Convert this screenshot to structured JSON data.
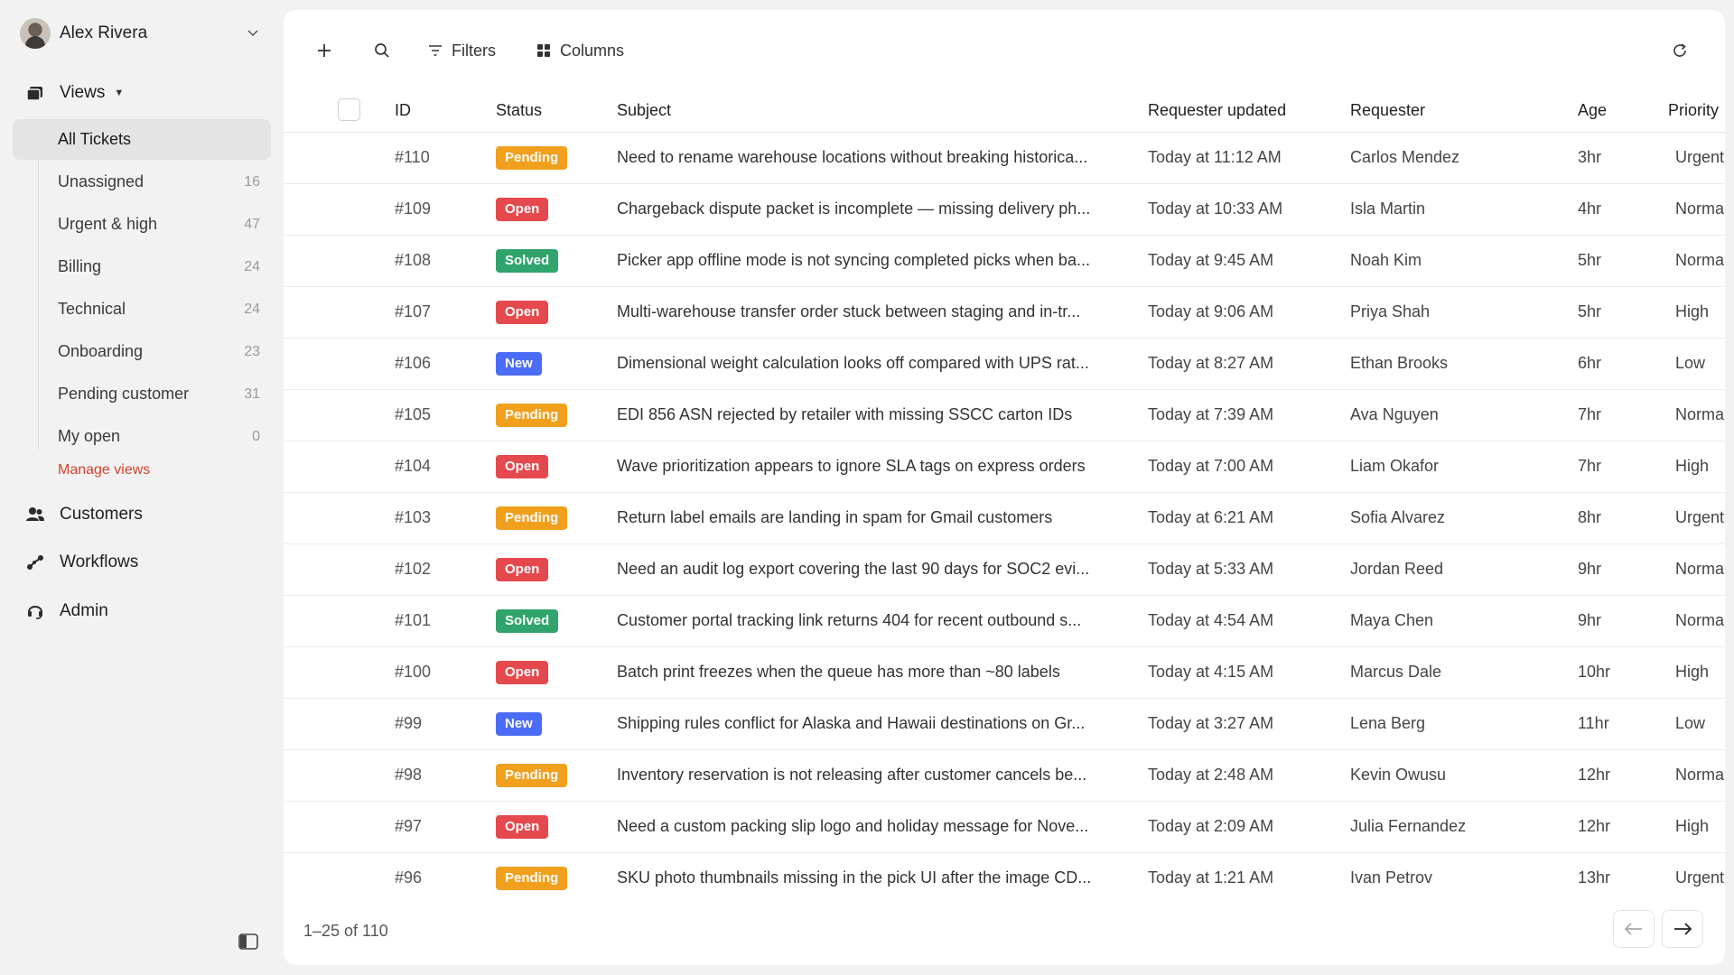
{
  "user": {
    "name": "Alex Rivera"
  },
  "nav": {
    "views_label": "Views",
    "views": [
      {
        "label": "All Tickets",
        "count": "",
        "active": true
      },
      {
        "label": "Unassigned",
        "count": "16"
      },
      {
        "label": "Urgent & high",
        "count": "47"
      },
      {
        "label": "Billing",
        "count": "24"
      },
      {
        "label": "Technical",
        "count": "24"
      },
      {
        "label": "Onboarding",
        "count": "23"
      },
      {
        "label": "Pending customer",
        "count": "31"
      },
      {
        "label": "My open",
        "count": "0"
      }
    ],
    "manage_views": "Manage views",
    "customers": "Customers",
    "workflows": "Workflows",
    "admin": "Admin"
  },
  "toolbar": {
    "filters": "Filters",
    "columns": "Columns"
  },
  "table": {
    "headers": {
      "id": "ID",
      "status": "Status",
      "subject": "Subject",
      "updated": "Requester updated",
      "requester": "Requester",
      "age": "Age",
      "priority": "Priority"
    },
    "rows": [
      {
        "id": "#110",
        "status": "Pending",
        "subject": "Need to rename warehouse locations without breaking historica...",
        "updated": "Today at 11:12 AM",
        "requester": "Carlos Mendez",
        "age": "3hr",
        "priority": "Urgent"
      },
      {
        "id": "#109",
        "status": "Open",
        "subject": "Chargeback dispute packet is incomplete — missing delivery ph...",
        "updated": "Today at 10:33 AM",
        "requester": "Isla Martin",
        "age": "4hr",
        "priority": "Normal"
      },
      {
        "id": "#108",
        "status": "Solved",
        "subject": "Picker app offline mode is not syncing completed picks when ba...",
        "updated": "Today at 9:45 AM",
        "requester": "Noah Kim",
        "age": "5hr",
        "priority": "Normal"
      },
      {
        "id": "#107",
        "status": "Open",
        "subject": "Multi-warehouse transfer order stuck between staging and in-tr...",
        "updated": "Today at 9:06 AM",
        "requester": "Priya Shah",
        "age": "5hr",
        "priority": "High"
      },
      {
        "id": "#106",
        "status": "New",
        "subject": "Dimensional weight calculation looks off compared with UPS rat...",
        "updated": "Today at 8:27 AM",
        "requester": "Ethan Brooks",
        "age": "6hr",
        "priority": "Low"
      },
      {
        "id": "#105",
        "status": "Pending",
        "subject": "EDI 856 ASN rejected by retailer with missing SSCC carton IDs",
        "updated": "Today at 7:39 AM",
        "requester": "Ava Nguyen",
        "age": "7hr",
        "priority": "Normal"
      },
      {
        "id": "#104",
        "status": "Open",
        "subject": "Wave prioritization appears to ignore SLA tags on express orders",
        "updated": "Today at 7:00 AM",
        "requester": "Liam Okafor",
        "age": "7hr",
        "priority": "High"
      },
      {
        "id": "#103",
        "status": "Pending",
        "subject": "Return label emails are landing in spam for Gmail customers",
        "updated": "Today at 6:21 AM",
        "requester": "Sofia Alvarez",
        "age": "8hr",
        "priority": "Urgent"
      },
      {
        "id": "#102",
        "status": "Open",
        "subject": "Need an audit log export covering the last 90 days for SOC2 evi...",
        "updated": "Today at 5:33 AM",
        "requester": "Jordan Reed",
        "age": "9hr",
        "priority": "Normal"
      },
      {
        "id": "#101",
        "status": "Solved",
        "subject": "Customer portal tracking link returns 404 for recent outbound s...",
        "updated": "Today at 4:54 AM",
        "requester": "Maya Chen",
        "age": "9hr",
        "priority": "Normal"
      },
      {
        "id": "#100",
        "status": "Open",
        "subject": "Batch print freezes when the queue has more than ~80 labels",
        "updated": "Today at 4:15 AM",
        "requester": "Marcus Dale",
        "age": "10hr",
        "priority": "High"
      },
      {
        "id": "#99",
        "status": "New",
        "subject": "Shipping rules conflict for Alaska and Hawaii destinations on Gr...",
        "updated": "Today at 3:27 AM",
        "requester": "Lena Berg",
        "age": "11hr",
        "priority": "Low"
      },
      {
        "id": "#98",
        "status": "Pending",
        "subject": "Inventory reservation is not releasing after customer cancels be...",
        "updated": "Today at 2:48 AM",
        "requester": "Kevin Owusu",
        "age": "12hr",
        "priority": "Normal"
      },
      {
        "id": "#97",
        "status": "Open",
        "subject": "Need a custom packing slip logo and holiday message for Nove...",
        "updated": "Today at 2:09 AM",
        "requester": "Julia Fernandez",
        "age": "12hr",
        "priority": "High"
      },
      {
        "id": "#96",
        "status": "Pending",
        "subject": "SKU photo thumbnails missing in the pick UI after the image CD...",
        "updated": "Today at 1:21 AM",
        "requester": "Ivan Petrov",
        "age": "13hr",
        "priority": "Urgent"
      }
    ]
  },
  "status_colors": {
    "Pending": "#f0a01c",
    "Open": "#e5484d",
    "Solved": "#30a46c",
    "New": "#4a6cf7"
  },
  "accent_color": "#d2442d",
  "pagination": {
    "range": "1–25 of 110"
  }
}
